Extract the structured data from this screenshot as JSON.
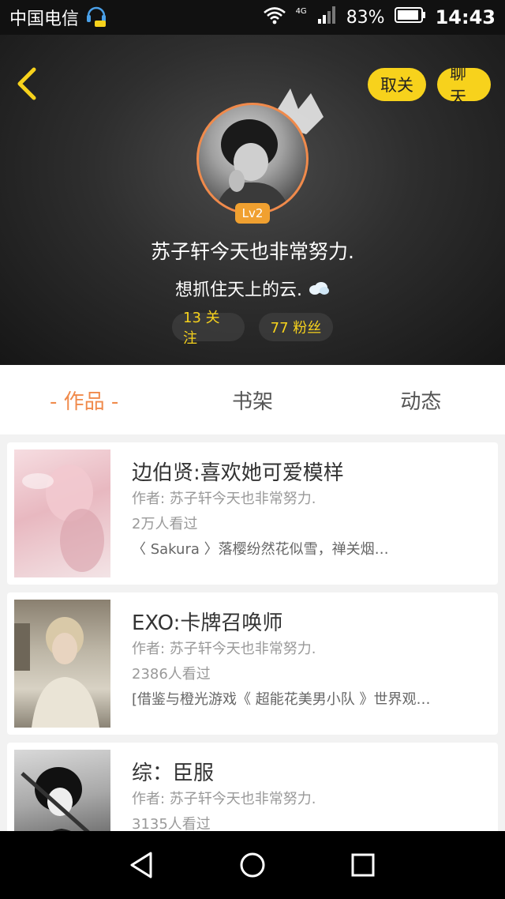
{
  "status_bar": {
    "carrier": "中国电信",
    "network": "4G",
    "battery": "83%",
    "time": "14:43"
  },
  "header": {
    "unfollow_label": "取关",
    "chat_label": "聊天",
    "level": "Lv2",
    "username": "苏子轩今天也非常努力.",
    "bio": "想抓住天上的云.",
    "following": "13 关注",
    "fans": "77 粉丝"
  },
  "tabs": [
    {
      "label": "- 作品 -",
      "active": true
    },
    {
      "label": "书架",
      "active": false
    },
    {
      "label": "动态",
      "active": false
    }
  ],
  "works": [
    {
      "title": "边伯贤:喜欢她可爱模样",
      "author": "作者: 苏子轩今天也非常努力.",
      "views": "2万人看过",
      "desc": "〈 Sakura 〉落樱纷然花似雪，禅关烟…"
    },
    {
      "title": "EXO:卡牌召唤师",
      "author": "作者: 苏子轩今天也非常努力.",
      "views": "2386人看过",
      "desc": "[借鉴与橙光游戏《 超能花美男小队 》世界观…"
    },
    {
      "title": "综：臣服",
      "author": "作者: 苏子轩今天也非常努力.",
      "views": "3135人看过",
      "desc": ""
    }
  ],
  "colors": {
    "accent": "#f08a4b",
    "yellow": "#f7d21c",
    "level_badge": "#f0a030"
  }
}
